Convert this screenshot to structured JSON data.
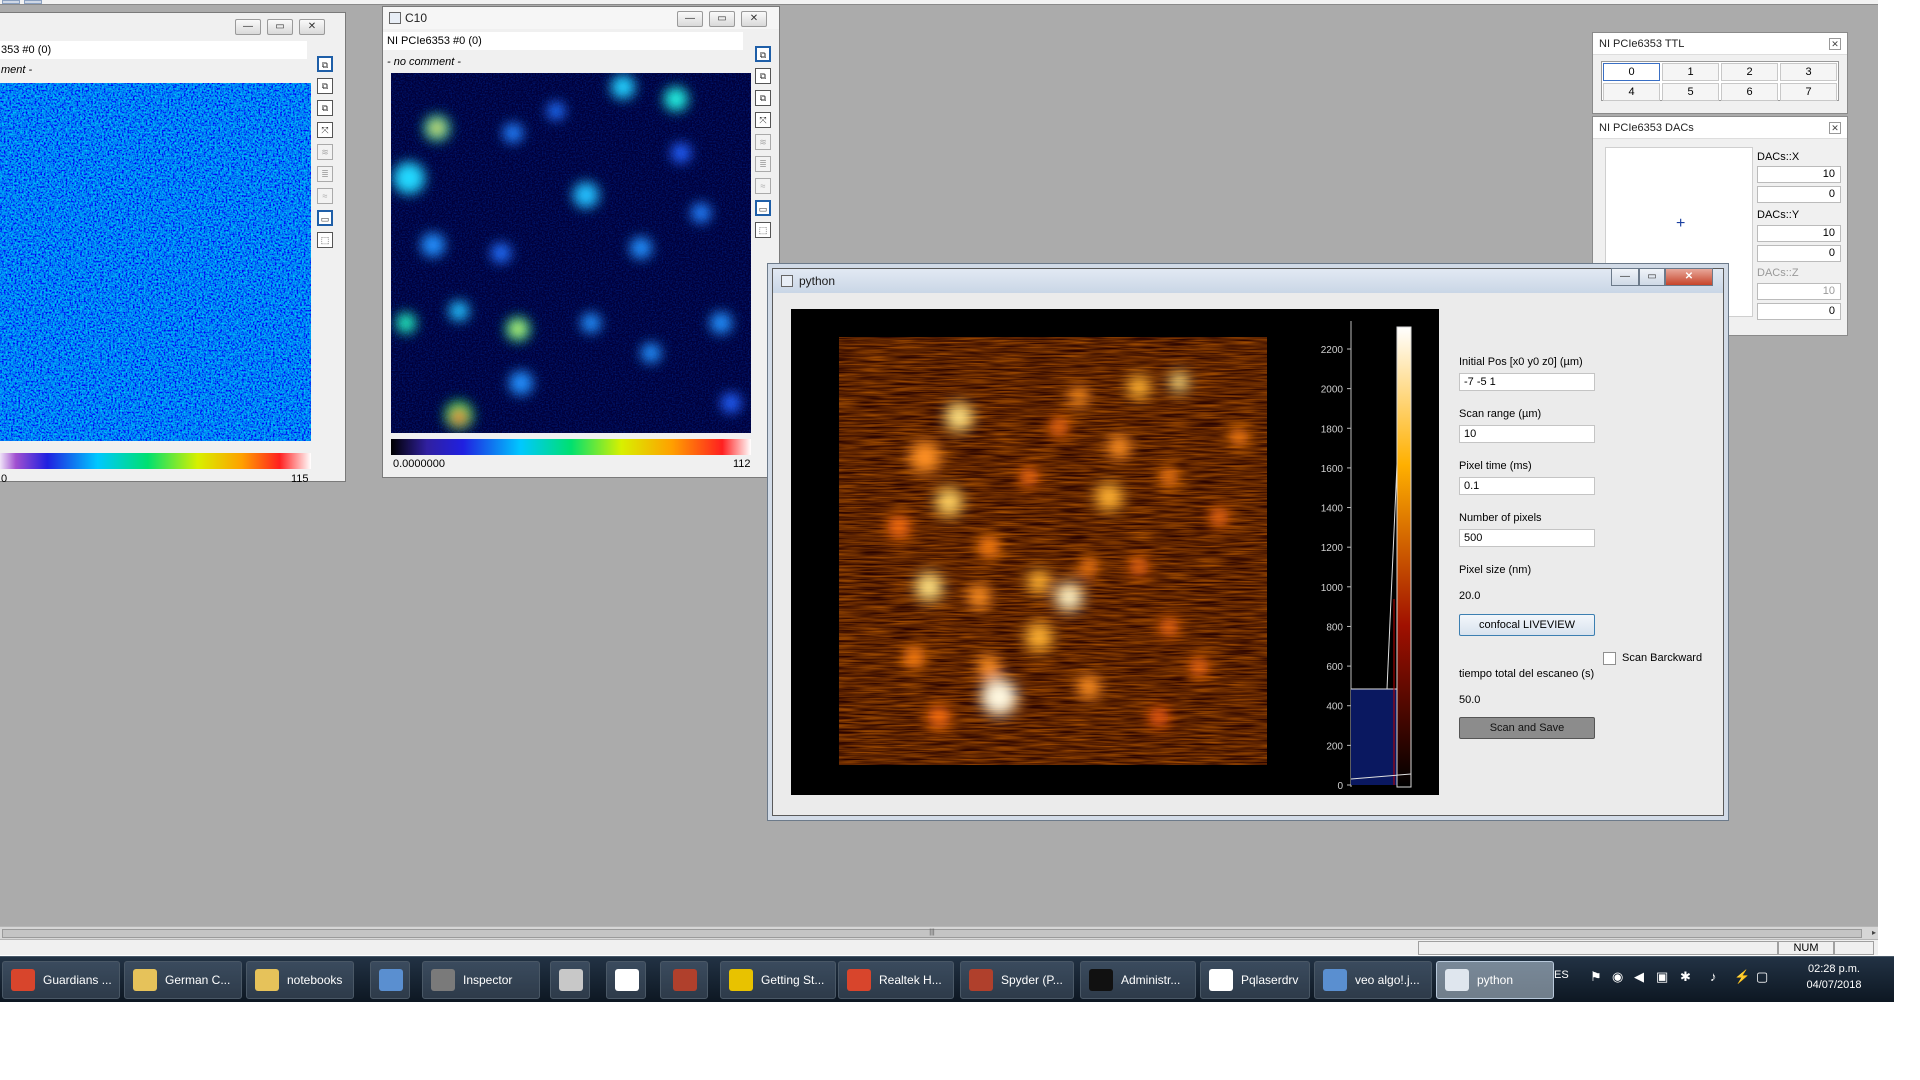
{
  "window_left": {
    "header1": "353 #0 (0)",
    "header2": "ment -",
    "cbar_min": "0",
    "cbar_max": "115",
    "title_buttons": [
      "—",
      "▭",
      "✕"
    ]
  },
  "window_c10": {
    "title": "C10",
    "header1": "NI PCIe6353 #0 (0)",
    "header2": "- no comment -",
    "cbar_min": "0.0000000",
    "cbar_max": "112",
    "title_buttons": [
      "—",
      "▭",
      "✕"
    ]
  },
  "ni_ttl": {
    "title": "NI PCIe6353 TTL",
    "channels": [
      "0",
      "1",
      "2",
      "3",
      "4",
      "5",
      "6",
      "7"
    ]
  },
  "ni_dacs": {
    "title": "NI PCIe6353 DACs",
    "x_label": "DACs::X",
    "x_values": [
      "10",
      "0"
    ],
    "y_label": "DACs::Y",
    "y_values": [
      "10",
      "0"
    ],
    "z_label": "DACs::Z",
    "z_values": [
      "10",
      "0"
    ]
  },
  "python_window": {
    "title": "python",
    "histogram_ticks": [
      "2200",
      "2000",
      "1800",
      "1600",
      "1400",
      "1200",
      "1000",
      "800",
      "600",
      "400",
      "200",
      "0"
    ],
    "initial_pos_label": "Initial Pos [x0 y0 z0] (µm)",
    "initial_pos_value": "-7 -5 1",
    "scan_range_label": "Scan range (µm)",
    "scan_range_value": "10",
    "pixel_time_label": "Pixel time (ms)",
    "pixel_time_value": "0.1",
    "num_pixels_label": "Number of pixels",
    "num_pixels_value": "500",
    "pixel_size_label": "Pixel size (nm)",
    "pixel_size_value": "20.0",
    "liveview_button": "confocal LIVEVIEW",
    "scan_backward_label": "Scan Barckward",
    "total_time_label": "tiempo total del escaneo (s)",
    "total_time_value": "50.0",
    "scan_save_button": "Scan and Save"
  },
  "statusbar": {
    "num": "NUM"
  },
  "taskbar": {
    "items": [
      {
        "label": "Guardians ...",
        "icon": "chrome-icon",
        "color": "#d8452c"
      },
      {
        "label": "German C...",
        "icon": "folder-icon",
        "color": "#e6c25a"
      },
      {
        "label": "notebooks",
        "icon": "folder-icon",
        "color": "#e6c25a"
      },
      {
        "label": "",
        "icon": "app-icon",
        "color": "#5a8fd0"
      },
      {
        "label": "Inspector",
        "icon": "inspector-icon",
        "color": "#7a7a7a"
      },
      {
        "label": "",
        "icon": "tool-icon",
        "color": "#c8c8c8"
      },
      {
        "label": "",
        "icon": "m-icon",
        "color": "#ffffff"
      },
      {
        "label": "",
        "icon": "spider-icon",
        "color": "#b0402c"
      },
      {
        "label": "Getting St...",
        "icon": "labview-icon",
        "color": "#e8c200"
      },
      {
        "label": "Realtek H...",
        "icon": "speaker-icon",
        "color": "#d8452c"
      },
      {
        "label": "Spyder (P...",
        "icon": "spyder-icon",
        "color": "#b0402c"
      },
      {
        "label": "Administr...",
        "icon": "console-icon",
        "color": "#111111"
      },
      {
        "label": "Pqlaserdrv",
        "icon": "m-icon",
        "color": "#ffffff"
      },
      {
        "label": "veo algo!.j...",
        "icon": "image-icon",
        "color": "#5a8fd0"
      },
      {
        "label": "python",
        "icon": "python-icon",
        "color": "#dfe6ee"
      }
    ],
    "language": "ES",
    "time": "02:28 p.m.",
    "date": "04/07/2018"
  }
}
